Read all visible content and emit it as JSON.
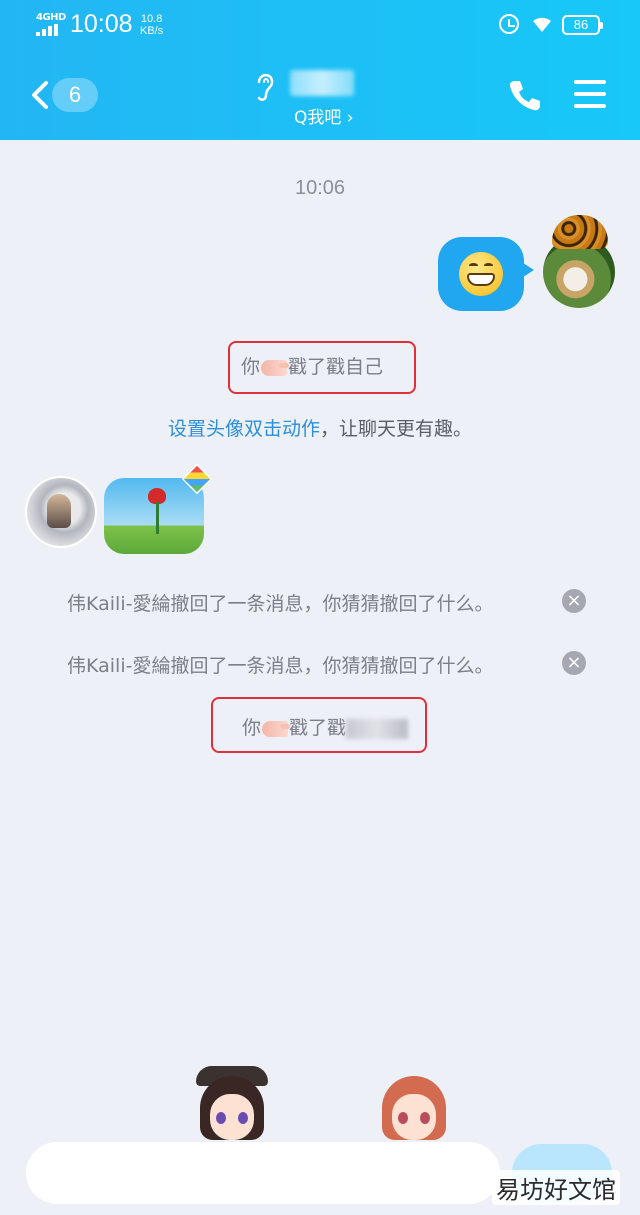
{
  "status_bar": {
    "network": "4GHD",
    "time": "10:08",
    "speed_value": "10.8",
    "speed_unit": "KB/s",
    "battery": "86"
  },
  "header": {
    "back_count": "6",
    "subtitle": "Q我吧 ›"
  },
  "chat": {
    "timestamp": "10:06",
    "poke_self": {
      "prefix": "你",
      "suffix": "戳了戳自己"
    },
    "tip": {
      "link": "设置头像双击动作",
      "rest": "，让聊天更有趣。"
    },
    "recall_messages": [
      "伟Kaili-愛綸撤回了一条消息，你猜猜撤回了什么。",
      "伟Kaili-愛綸撤回了一条消息，你猜猜撤回了什么。"
    ],
    "poke_other": {
      "prefix": "你",
      "suffix": "戳了戳"
    }
  },
  "input": {
    "send_label": ""
  },
  "watermark": "易坊好文馆",
  "colors": {
    "header": "#1fbcf5",
    "my_bubble": "#20a7f0",
    "highlight": "#e0303a",
    "link": "#2c8fd8"
  }
}
